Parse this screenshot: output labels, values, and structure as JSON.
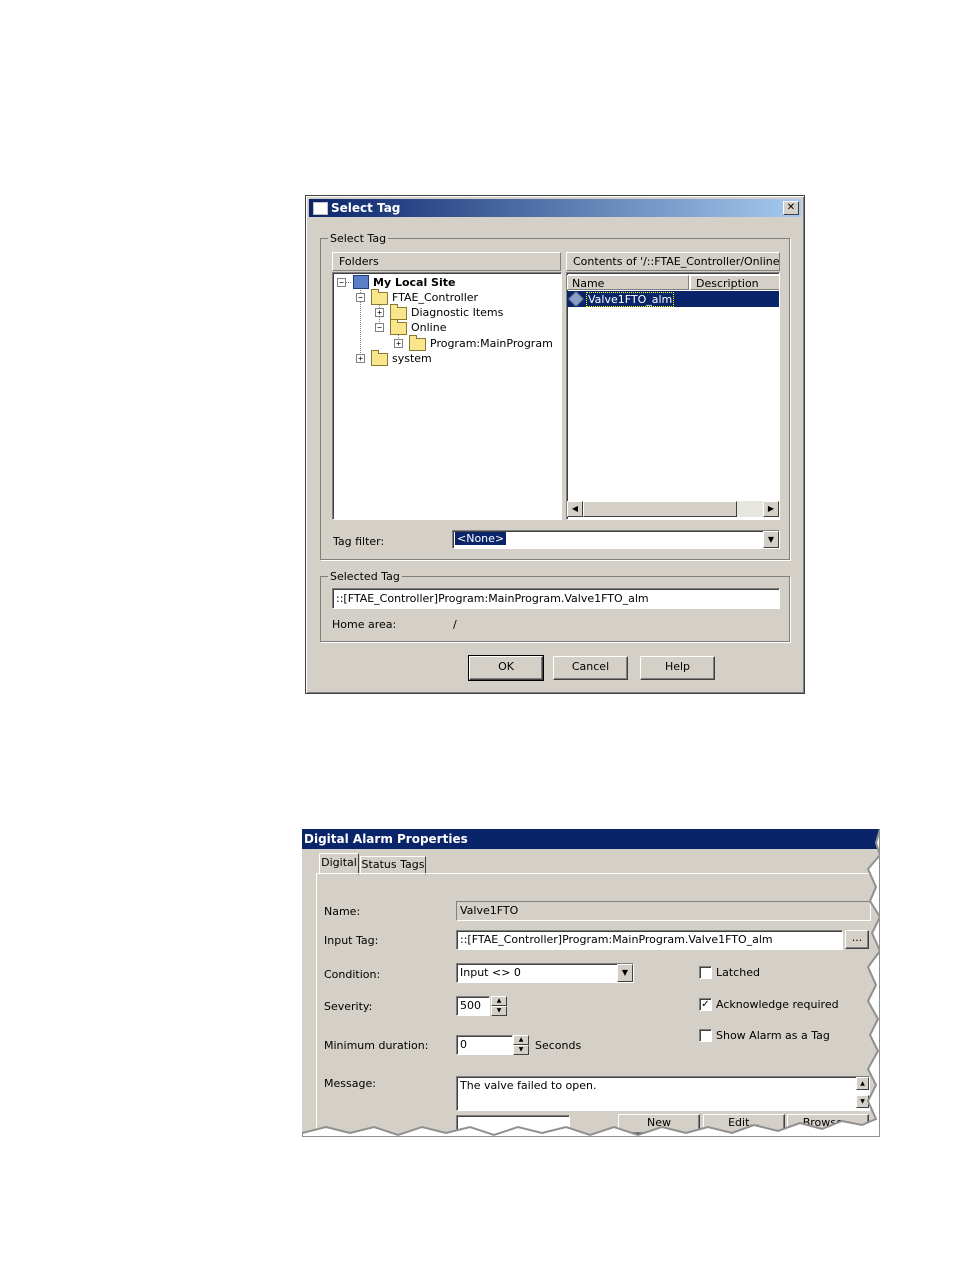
{
  "select_tag": {
    "title": "Select Tag",
    "close_glyph": "✕",
    "group_label": "Select Tag",
    "folders_header": "Folders",
    "contents_header": "Contents of '/::FTAE_Controller/Online/Prog",
    "tree": {
      "root": "My Local Site",
      "controller": "FTAE_Controller",
      "diagnostic": "Diagnostic Items",
      "online": "Online",
      "program": "Program:MainProgram",
      "system": "system"
    },
    "columns": {
      "name": "Name",
      "description": "Description"
    },
    "row_name": "Valve1FTO_alm",
    "tag_filter_label": "Tag filter:",
    "tag_filter_value": "<None>",
    "selected_tag_group": "Selected Tag",
    "selected_tag_value": "::[FTAE_Controller]Program:MainProgram.Valve1FTO_alm",
    "home_area_label": "Home area:",
    "home_area_value": "/",
    "ok": "OK",
    "cancel": "Cancel",
    "help": "Help"
  },
  "alarm": {
    "title": "Digital Alarm Properties",
    "tab_digital": "Digital",
    "tab_status": "Status Tags",
    "name_label": "Name:",
    "name_value": "Valve1FTO",
    "input_tag_label": "Input Tag:",
    "input_tag_value": "::[FTAE_Controller]Program:MainProgram.Valve1FTO_alm",
    "browse_dots": "...",
    "condition_label": "Condition:",
    "condition_value": "Input <> 0",
    "severity_label": "Severity:",
    "severity_value": "500",
    "min_duration_label": "Minimum duration:",
    "min_duration_value": "0",
    "seconds_label": "Seconds",
    "latched_label": "Latched",
    "ack_label": "Acknowledge required",
    "show_alarm_label": "Show Alarm as a Tag",
    "message_label": "Message:",
    "message_value": "The valve failed to open.",
    "bottom_new": "New",
    "bottom_edit": "Edit...",
    "bottom_browse": "Browse..."
  },
  "colors": {
    "face": "#d4d0c8",
    "title_dark": "#0a246a",
    "title_light": "#a6caf0",
    "selection": "#0a246a"
  }
}
